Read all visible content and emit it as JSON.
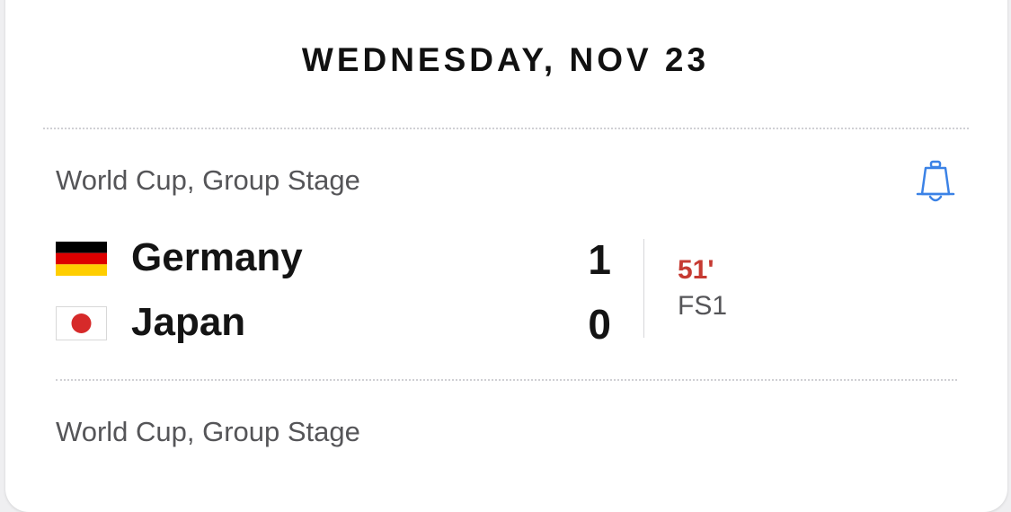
{
  "date_header": "WEDNESDAY, NOV 23",
  "matches": [
    {
      "league": "World Cup, Group Stage",
      "notify_icon": "bell-icon",
      "teams": [
        {
          "name": "Germany",
          "score": "1",
          "flag_icon": "germany-flag-icon"
        },
        {
          "name": "Japan",
          "score": "0",
          "flag_icon": "japan-flag-icon"
        }
      ],
      "clock": "51'",
      "network": "FS1"
    },
    {
      "league": "World Cup, Group Stage"
    }
  ],
  "colors": {
    "live_clock": "#c63a32",
    "accent_blue": "#3b82e6",
    "text_primary": "#141414",
    "text_secondary": "#555558"
  }
}
